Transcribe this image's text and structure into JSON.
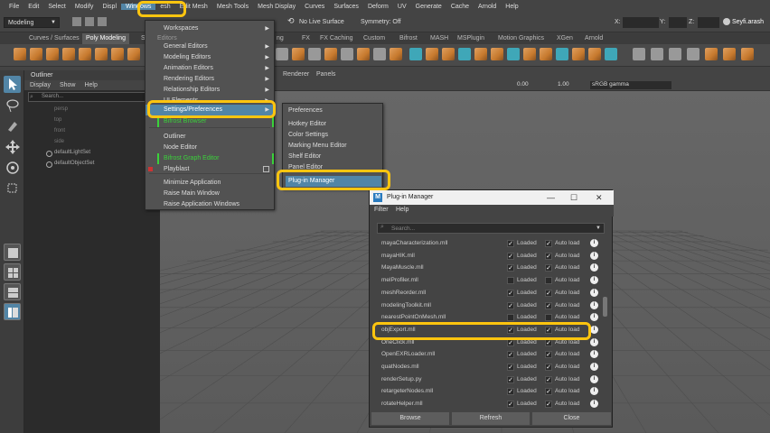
{
  "menubar": [
    "File",
    "Edit",
    "Select",
    "Modify",
    "Displ",
    "Windows",
    "esh",
    "Edit Mesh",
    "Mesh Tools",
    "Mesh Display",
    "Curves",
    "Surfaces",
    "Deform",
    "UV",
    "Generate",
    "Cache",
    "Arnold",
    "Help"
  ],
  "statusline": {
    "mode": "Modeling",
    "live_surface": "No Live Surface",
    "symmetry": "Symmetry: Off",
    "x_label": "X:",
    "y_label": "Y:",
    "z_label": "Z:",
    "user": "Seyfi.arash"
  },
  "shelf_tabs": [
    "Curves / Surfaces",
    "Poly Modeling",
    "Sc",
    "ng",
    "FX",
    "FX Caching",
    "Custom",
    "Bifrost",
    "MASH",
    "MSPlugin",
    "Motion Graphics",
    "XGen",
    "Arnold"
  ],
  "outliner": {
    "title": "Outliner",
    "menu": [
      "Display",
      "Show",
      "Help"
    ],
    "search_placeholder": "Search...",
    "items": [
      "persp",
      "top",
      "front",
      "side",
      "defaultLightSet",
      "defaultObjectSet"
    ]
  },
  "viewport": {
    "menu": [
      "Renderer",
      "Panels"
    ],
    "value_a": "0.00",
    "value_b": "1.00",
    "colorspace": "sRGB gamma"
  },
  "windows_menu": {
    "items": [
      {
        "label": "Workspaces",
        "arrow": true,
        "kind": "normal"
      },
      {
        "label": "Editors",
        "kind": "label"
      },
      {
        "label": "General Editors",
        "arrow": true,
        "kind": "normal"
      },
      {
        "label": "Modeling Editors",
        "arrow": true,
        "kind": "normal"
      },
      {
        "label": "Animation Editors",
        "arrow": true,
        "kind": "normal"
      },
      {
        "label": "Rendering Editors",
        "arrow": true,
        "kind": "normal"
      },
      {
        "label": "Relationship Editors",
        "arrow": true,
        "kind": "normal"
      },
      {
        "label": "UI Elements",
        "arrow": true,
        "kind": "normal"
      },
      {
        "label": "Settings/Preferences",
        "arrow": true,
        "kind": "highlight"
      },
      {
        "label": "Bifrost Browser",
        "kind": "green"
      },
      {
        "label": "Outliner",
        "kind": "normal"
      },
      {
        "label": "Node Editor",
        "kind": "normal"
      },
      {
        "label": "Bifrost Graph Editor",
        "kind": "green"
      },
      {
        "label": "Playblast",
        "kind": "normal"
      },
      {
        "label": "Minimize Application",
        "kind": "normal"
      },
      {
        "label": "Raise Main Window",
        "kind": "normal"
      },
      {
        "label": "Raise Application Windows",
        "kind": "normal"
      }
    ]
  },
  "settings_menu": {
    "items": [
      "Preferences",
      "Hotkey Editor",
      "Color Settings",
      "Marking Menu Editor",
      "Shelf Editor",
      "Panel Editor",
      "Plug-in Manager"
    ]
  },
  "plugin_manager": {
    "title": "Plug-in Manager",
    "menu": [
      "Filter",
      "Help"
    ],
    "search_placeholder": "Search...",
    "loaded_label": "Loaded",
    "autoload_label": "Auto load",
    "rows": [
      {
        "name": "mayaCharacterization.mll",
        "loaded": true,
        "autoload": true
      },
      {
        "name": "mayaHIK.mll",
        "loaded": true,
        "autoload": true
      },
      {
        "name": "MayaMuscle.mll",
        "loaded": true,
        "autoload": true
      },
      {
        "name": "melProfiler.mll",
        "loaded": false,
        "autoload": false
      },
      {
        "name": "meshReorder.mll",
        "loaded": true,
        "autoload": true
      },
      {
        "name": "modelingToolkit.mll",
        "loaded": true,
        "autoload": true
      },
      {
        "name": "nearestPointOnMesh.mll",
        "loaded": false,
        "autoload": false
      },
      {
        "name": "objExport.mll",
        "loaded": true,
        "autoload": true
      },
      {
        "name": "OneClick.mll",
        "loaded": true,
        "autoload": true
      },
      {
        "name": "OpenEXRLoader.mll",
        "loaded": true,
        "autoload": true
      },
      {
        "name": "quatNodes.mll",
        "loaded": true,
        "autoload": true
      },
      {
        "name": "renderSetup.py",
        "loaded": true,
        "autoload": true
      },
      {
        "name": "retargeterNodes.mll",
        "loaded": true,
        "autoload": true
      },
      {
        "name": "rotateHelper.mll",
        "loaded": true,
        "autoload": true
      }
    ],
    "buttons": [
      "Browse",
      "Refresh",
      "Close"
    ]
  },
  "colors": {
    "highlight_yellow": "#ffc50f",
    "menu_highlight": "#5285a6",
    "bifrost_green": "#3ad23a"
  }
}
